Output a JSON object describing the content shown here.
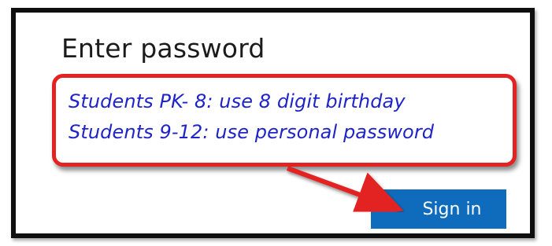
{
  "dialog": {
    "title": "Enter password",
    "sign_in_label": "Sign in"
  },
  "callout": {
    "line1": "Students PK- 8: use 8 digit birthday",
    "line2": "Students 9-12: use personal password"
  },
  "colors": {
    "button": "#0f6cbd",
    "callout_border": "#e32222",
    "callout_text": "#1f24c7",
    "arrow": "#e32222"
  }
}
